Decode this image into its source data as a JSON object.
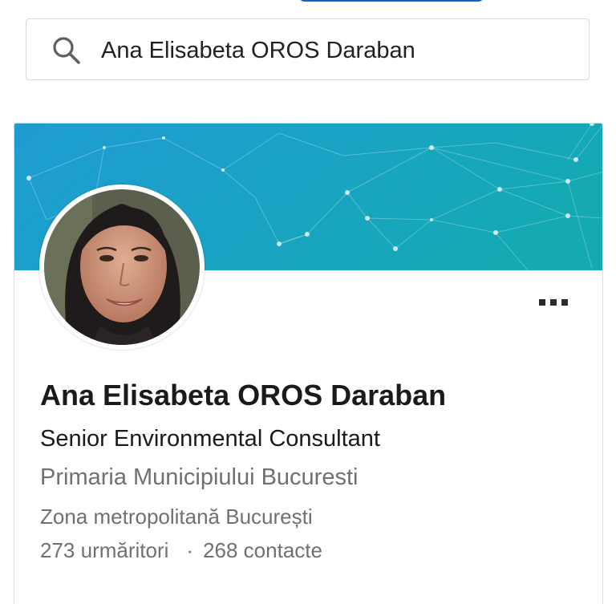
{
  "search": {
    "query": "Ana Elisabeta OROS Daraban",
    "icon": "search-icon"
  },
  "profile": {
    "name": "Ana Elisabeta OROS Daraban",
    "headline": "Senior Environmental Consultant",
    "company": "Primaria Municipiului Bucuresti",
    "location": "Zona metropolitană București",
    "followers": "273 urmăritori",
    "separator": "·",
    "connections": "268 contacte",
    "more_icon": "more-horizontal-icon"
  },
  "colors": {
    "banner_left": "#1b9fd0",
    "banner_right": "#17a7b6",
    "accent": "#0a66c2",
    "secondary_text": "#707070"
  }
}
